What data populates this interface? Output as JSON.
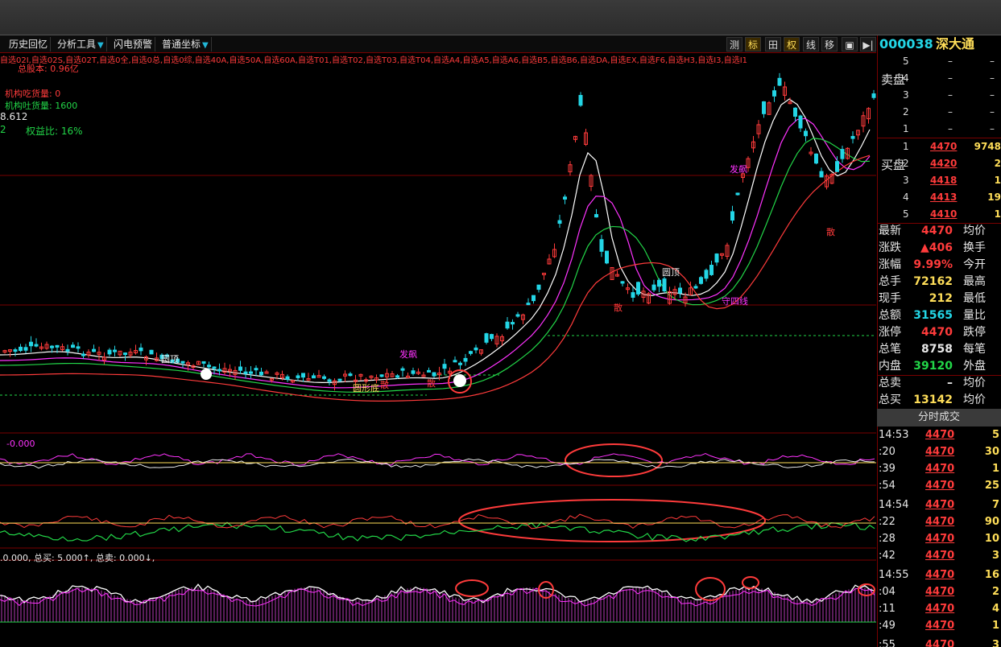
{
  "toolbar": {
    "items": [
      "历史回忆",
      "分析工具",
      "闪电预警",
      "普通坐标"
    ],
    "right_buttons": [
      "测",
      "标",
      "田",
      "权",
      "线",
      "移",
      "▣",
      "▶|"
    ]
  },
  "header_row": "自选02I,自选02S,自选02T,自选0全,自选0总,自选0综,自选40A,自选50A,自选60A,自选T01,自选T02,自选T03,自选T04,自选A4,自选A5,自选A6,自选B5,自选B6,自选DA,自选EX,自选F6,自选H3,自选I3,自选I1",
  "info": {
    "total_cap": "总股本: 0.96亿",
    "absorb": "机构吃货量: 0",
    "spit": "机构吐货量: 1600",
    "val": "8.612",
    "ratio_num": "2",
    "ratio": "权益比: 16%"
  },
  "labels": {
    "yuanding1": "圆顶",
    "yuanding2": "圆顶",
    "yuanxiadi": "圆形底",
    "fazu": "发飙",
    "fazu2": "发飙",
    "san": "散",
    "san2": "散",
    "san3": "散",
    "san4": "散",
    "shousi": "守四线",
    "neg": "-0.000"
  },
  "sub_legend": ".0.000, 总买: 5.000↑, 总卖: 0.000↓,",
  "code": {
    "num": "000038",
    "name": "深大通"
  },
  "sell": [
    {
      "lv": "5",
      "price": "–",
      "vol": "–"
    },
    {
      "lv": "4",
      "price": "–",
      "vol": "–"
    },
    {
      "lv": "3",
      "price": "–",
      "vol": "–"
    },
    {
      "lv": "2",
      "price": "–",
      "vol": "–"
    },
    {
      "lv": "1",
      "price": "–",
      "vol": "–"
    }
  ],
  "buy": [
    {
      "lv": "1",
      "price": "4470",
      "vol": "9748"
    },
    {
      "lv": "2",
      "price": "4420",
      "vol": "2"
    },
    {
      "lv": "3",
      "price": "4418",
      "vol": "1"
    },
    {
      "lv": "4",
      "price": "4413",
      "vol": "19"
    },
    {
      "lv": "5",
      "price": "4410",
      "vol": "1"
    }
  ],
  "stats": [
    {
      "k": "最新",
      "v": "4470",
      "k2": "均价",
      "c": "#ff3b3b"
    },
    {
      "k": "涨跌",
      "v": "▲406",
      "k2": "换手",
      "c": "#ff3b3b"
    },
    {
      "k": "涨幅",
      "v": "9.99%",
      "k2": "今开",
      "c": "#ff3b3b"
    },
    {
      "k": "总手",
      "v": "72162",
      "k2": "最高",
      "c": "#ffde59"
    },
    {
      "k": "现手",
      "v": "212",
      "k2": "最低",
      "c": "#ffde59"
    },
    {
      "k": "总额",
      "v": "31565",
      "k2": "量比",
      "c": "#23d6e6"
    },
    {
      "k": "涨停",
      "v": "4470",
      "k2": "跌停",
      "c": "#ff3b3b"
    },
    {
      "k": "总笔",
      "v": "8758",
      "k2": "每笔",
      "c": "#e8e8e8"
    },
    {
      "k": "内盘",
      "v": "39120",
      "k2": "外盘",
      "c": "#22d648"
    },
    {
      "k": "总卖",
      "v": "–",
      "k2": "均价",
      "c": "#e8e8e8"
    },
    {
      "k": "总买",
      "v": "13142",
      "k2": "均价",
      "c": "#ffde59"
    }
  ],
  "ticks_title": "分时成交",
  "ticks": [
    {
      "t": "14:53",
      "p": "4470",
      "v": "5"
    },
    {
      "t": ":20",
      "p": "4470",
      "v": "30"
    },
    {
      "t": ":39",
      "p": "4470",
      "v": "1"
    },
    {
      "t": ":54",
      "p": "4470",
      "v": "25"
    },
    {
      "t": "14:54",
      "p": "4470",
      "v": "7"
    },
    {
      "t": ":22",
      "p": "4470",
      "v": "90"
    },
    {
      "t": ":28",
      "p": "4470",
      "v": "10"
    },
    {
      "t": ":42",
      "p": "4470",
      "v": "3"
    },
    {
      "t": "14:55",
      "p": "4470",
      "v": "16"
    },
    {
      "t": ":04",
      "p": "4470",
      "v": "2"
    },
    {
      "t": ":11",
      "p": "4470",
      "v": "4"
    },
    {
      "t": ":49",
      "p": "4470",
      "v": "1"
    },
    {
      "t": ":55",
      "p": "4470",
      "v": "3"
    }
  ],
  "sidebar": {
    "sell_label": "卖盘",
    "buy_label": "买盘"
  },
  "colors": {
    "up": "#ff3b3b",
    "down": "#23d6e6",
    "ma1": "#ffffff",
    "ma2": "#ff33ff",
    "ma3": "#22d648",
    "ma4": "#ff3b3b"
  }
}
